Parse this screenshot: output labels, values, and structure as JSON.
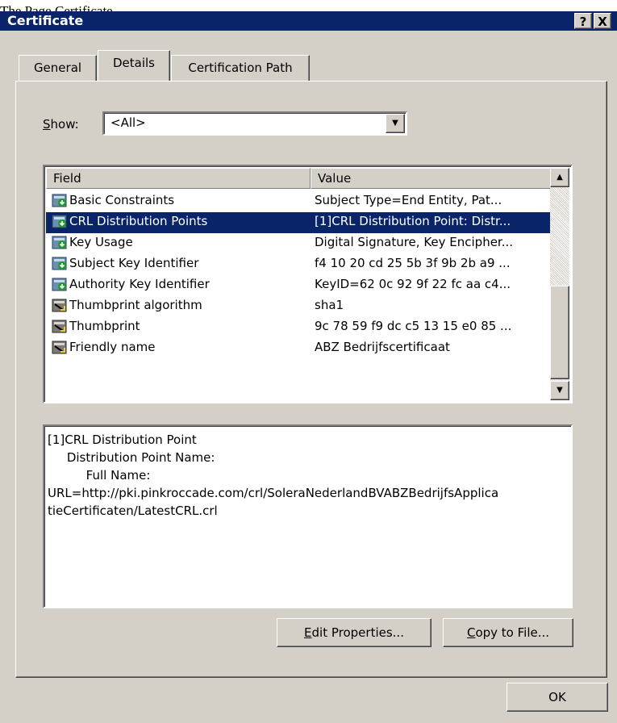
{
  "clipped_text": "The Page Certificate...",
  "window": {
    "title": "Certificate",
    "help_button": "?",
    "close_button": "X"
  },
  "tabs": [
    {
      "label": "General",
      "active": false
    },
    {
      "label": "Details",
      "active": true
    },
    {
      "label": "Certification Path",
      "active": false
    }
  ],
  "show": {
    "label_accel": "S",
    "label_rest": "how:",
    "value": "<All>"
  },
  "list": {
    "columns": [
      "Field",
      "Value"
    ],
    "rows": [
      {
        "icon": "extension-icon",
        "field": "Basic Constraints",
        "value": "Subject Type=End Entity, Pat...",
        "selected": false
      },
      {
        "icon": "extension-icon",
        "field": "CRL Distribution Points",
        "value": "[1]CRL Distribution Point: Distr...",
        "selected": true
      },
      {
        "icon": "extension-icon",
        "field": "Key Usage",
        "value": "Digital Signature, Key Encipher...",
        "selected": false
      },
      {
        "icon": "extension-icon",
        "field": "Subject Key Identifier",
        "value": "f4 10 20 cd 25 5b 3f 9b 2b a9 ...",
        "selected": false
      },
      {
        "icon": "extension-icon",
        "field": "Authority Key Identifier",
        "value": "KeyID=62 0c 92 9f 22 fc aa c4...",
        "selected": false
      },
      {
        "icon": "property-icon",
        "field": "Thumbprint algorithm",
        "value": "sha1",
        "selected": false
      },
      {
        "icon": "property-icon",
        "field": "Thumbprint",
        "value": "9c 78 59 f9 dc c5 13 15 e0 85 ...",
        "selected": false
      },
      {
        "icon": "property-icon",
        "field": "Friendly name",
        "value": "ABZ Bedrijfscertificaat",
        "selected": false
      }
    ]
  },
  "details_text": [
    "[1]CRL Distribution Point",
    "     Distribution Point Name:",
    "          Full Name:",
    "",
    "URL=http://pki.pinkroccade.com/crl/SoleraNederlandBVABZBedrijfsApplica",
    "tieCertificaten/LatestCRL.crl"
  ],
  "buttons": {
    "edit_accel": "E",
    "edit_rest": "dit Properties...",
    "copy_accel": "C",
    "copy_rest": "opy to File...",
    "ok": "OK"
  },
  "colors": {
    "selection": "#0a246a",
    "dialog_face": "#d4d0c8"
  }
}
